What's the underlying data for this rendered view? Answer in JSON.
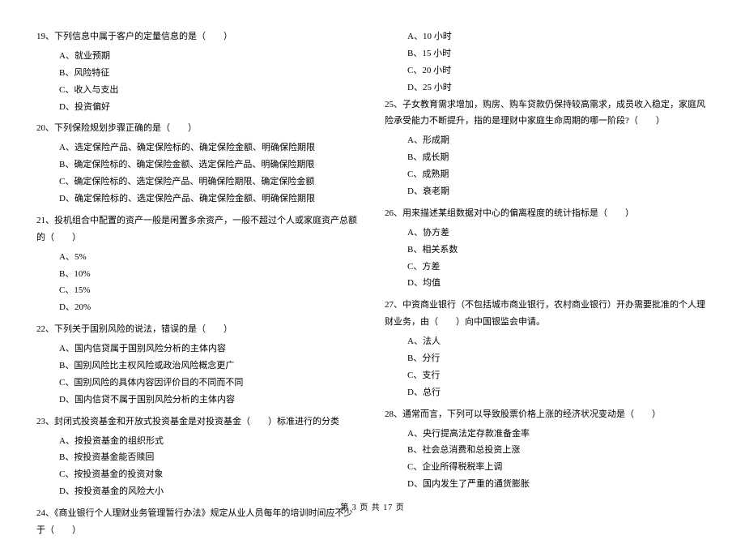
{
  "left_column": [
    {
      "num": "19、",
      "text": "下列信息中属于客户的定量信息的是（　　）",
      "options": [
        "A、就业预期",
        "B、风险特征",
        "C、收入与支出",
        "D、投资偏好"
      ]
    },
    {
      "num": "20、",
      "text": "下列保险规划步骤正确的是（　　）",
      "options": [
        "A、选定保险产品、确定保险标的、确定保险金额、明确保险期限",
        "B、确定保险标的、确定保险金额、选定保险产品、明确保险期限",
        "C、确定保险标的、选定保险产品、明确保险期限、确定保险金额",
        "D、确定保险标的、选定保险产品、确定保险金额、明确保险期限"
      ]
    },
    {
      "num": "21、",
      "text": "投机组合中配置的资产一般是闲置多余资产，一般不超过个人或家庭资产总额的（　　）",
      "options": [
        "A、5%",
        "B、10%",
        "C、15%",
        "D、20%"
      ]
    },
    {
      "num": "22、",
      "text": "下列关于国别风险的说法，错误的是（　　）",
      "options": [
        "A、国内信贷属于国别风险分析的主体内容",
        "B、国别风险比主权风险或政治风险概念更广",
        "C、国别风险的具体内容因评价目的不同而不同",
        "D、国内信贷不属于国别风险分析的主体内容"
      ]
    },
    {
      "num": "23、",
      "text": "封闭式投资基金和开放式投资基金是对投资基金（　　）标准进行的分类",
      "options": [
        "A、按投资基金的组织形式",
        "B、按投资基金能否赎回",
        "C、按投资基金的投资对象",
        "D、按投资基金的风险大小"
      ]
    },
    {
      "num": "24、",
      "text": "《商业银行个人理财业务管理暂行办法》规定从业人员每年的培训时间应不少于（　　）",
      "options": []
    }
  ],
  "right_column_pre_options": [
    "A、10 小时",
    "B、15 小时",
    "C、20 小时",
    "D、25 小时"
  ],
  "right_column": [
    {
      "num": "25、",
      "text": "子女教育需求增加，购房、购车贷款仍保持较高需求，成员收入稳定，家庭风险承受能力不断提升，指的是理财中家庭生命周期的哪一阶段?（　　）",
      "options": [
        "A、形成期",
        "B、成长期",
        "C、成熟期",
        "D、衰老期"
      ]
    },
    {
      "num": "26、",
      "text": "用来描述某组数据对中心的偏离程度的统计指标是（　　）",
      "options": [
        "A、协方差",
        "B、相关系数",
        "C、方差",
        "D、均值"
      ]
    },
    {
      "num": "27、",
      "text": "中资商业银行（不包括城市商业银行，农村商业银行）开办需要批准的个人理财业务，由（　　）向中国银监会申请。",
      "options": [
        "A、法人",
        "B、分行",
        "C、支行",
        "D、总行"
      ]
    },
    {
      "num": "28、",
      "text": "通常而言，下列可以导致股票价格上涨的经济状况变动是（　　）",
      "options": [
        "A、央行提高法定存款准备金率",
        "B、社会总消费和总投资上涨",
        "C、企业所得税税率上调",
        "D、国内发生了严重的通货膨胀"
      ]
    }
  ],
  "footer": "第 3 页 共 17 页"
}
